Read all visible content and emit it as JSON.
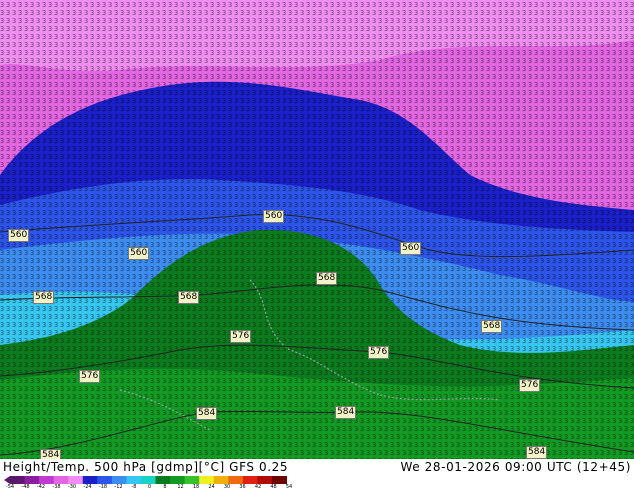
{
  "map": {
    "contour_labels": [
      "560",
      "560",
      "560",
      "568",
      "568",
      "568",
      "568",
      "576",
      "576",
      "576",
      "576",
      "584",
      "584",
      "584",
      "584",
      "560"
    ],
    "colors": {
      "magenta": "#e366e3",
      "light_magenta": "#ef8ef0",
      "dark_blue": "#1a1fc8",
      "mid_blue": "#2d54e8",
      "light_blue": "#3d8cf0",
      "cyan": "#37c6f0",
      "dark_green": "#0a7b1e",
      "green": "#129a24",
      "land_green": "#0f8a1e",
      "coastline": "#9aa0a0"
    }
  },
  "footer": {
    "title": "Height/Temp. 500 hPa [gdmp][°C] GFS 0.25",
    "datetime": "We 28-01-2026 09:00 UTC (12+45)"
  },
  "scale": {
    "ticks": [
      "-54",
      "-48",
      "-42",
      "-38",
      "-30",
      "-24",
      "-18",
      "-12",
      "-8",
      "0",
      "8",
      "12",
      "18",
      "24",
      "30",
      "36",
      "42",
      "48",
      "54"
    ],
    "colors": [
      "#5a1a6b",
      "#8a1fa0",
      "#c23bd0",
      "#e366e3",
      "#ef8ef0",
      "#1a1fc8",
      "#2d54e8",
      "#3d8cf0",
      "#37c6f0",
      "#17d4c6",
      "#0a7b1e",
      "#129a24",
      "#35c22c",
      "#f0f020",
      "#f0b010",
      "#f06a10",
      "#e02010",
      "#b00a0a",
      "#6e0505"
    ]
  }
}
